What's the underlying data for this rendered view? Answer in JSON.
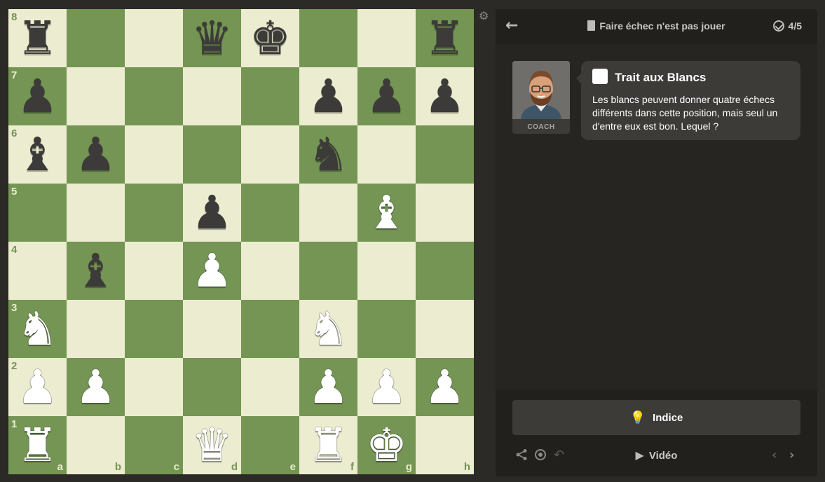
{
  "board": {
    "files": [
      "a",
      "b",
      "c",
      "d",
      "e",
      "f",
      "g",
      "h"
    ],
    "ranks": [
      "8",
      "7",
      "6",
      "5",
      "4",
      "3",
      "2",
      "1"
    ],
    "pieces": {
      "a8": {
        "color": "b",
        "type": "rook",
        "glyph": "♜"
      },
      "d8": {
        "color": "b",
        "type": "queen",
        "glyph": "♛"
      },
      "e8": {
        "color": "b",
        "type": "king",
        "glyph": "♚"
      },
      "h8": {
        "color": "b",
        "type": "rook",
        "glyph": "♜"
      },
      "a7": {
        "color": "b",
        "type": "pawn",
        "glyph": "♟"
      },
      "f7": {
        "color": "b",
        "type": "pawn",
        "glyph": "♟"
      },
      "g7": {
        "color": "b",
        "type": "pawn",
        "glyph": "♟"
      },
      "h7": {
        "color": "b",
        "type": "pawn",
        "glyph": "♟"
      },
      "a6": {
        "color": "b",
        "type": "bishop",
        "glyph": "♝"
      },
      "b6": {
        "color": "b",
        "type": "pawn",
        "glyph": "♟"
      },
      "f6": {
        "color": "b",
        "type": "knight",
        "glyph": "♞"
      },
      "d5": {
        "color": "b",
        "type": "pawn",
        "glyph": "♟"
      },
      "g5": {
        "color": "w",
        "type": "bishop",
        "glyph": "♝"
      },
      "b4": {
        "color": "b",
        "type": "bishop",
        "glyph": "♝"
      },
      "d4": {
        "color": "w",
        "type": "pawn",
        "glyph": "♟"
      },
      "a3": {
        "color": "w",
        "type": "knight",
        "glyph": "♞"
      },
      "f3": {
        "color": "w",
        "type": "knight",
        "glyph": "♞"
      },
      "a2": {
        "color": "w",
        "type": "pawn",
        "glyph": "♟"
      },
      "b2": {
        "color": "w",
        "type": "pawn",
        "glyph": "♟"
      },
      "f2": {
        "color": "w",
        "type": "pawn",
        "glyph": "♟"
      },
      "g2": {
        "color": "w",
        "type": "pawn",
        "glyph": "♟"
      },
      "h2": {
        "color": "w",
        "type": "pawn",
        "glyph": "♟"
      },
      "a1": {
        "color": "w",
        "type": "rook",
        "glyph": "♜"
      },
      "d1": {
        "color": "w",
        "type": "queen",
        "glyph": "♛"
      },
      "f1": {
        "color": "w",
        "type": "rook",
        "glyph": "♜"
      },
      "g1": {
        "color": "w",
        "type": "king",
        "glyph": "♚"
      }
    }
  },
  "colors": {
    "light_square": "#ececd0",
    "dark_square": "#749553",
    "panel_bg": "#262522",
    "bubble_bg": "#3c3b38"
  },
  "header": {
    "lesson_title": "Faire échec n'est pas jouer",
    "progress": "4/5",
    "icons": {
      "back": "arrow-left-icon",
      "lesson": "book-icon",
      "progress": "check-circle-icon"
    }
  },
  "coach": {
    "label": "COACH"
  },
  "bubble": {
    "title": "Trait aux Blancs",
    "message": "Les blancs peuvent donner quatre échecs différents dans cette position, mais seul un d'entre eux est bon. Lequel ?"
  },
  "footer": {
    "hint_label": "Indice",
    "video_label": "Vidéo",
    "icons": [
      "share-icon",
      "target-icon",
      "undo-icon",
      "play-icon",
      "chevron-left-icon",
      "chevron-right-icon",
      "lightbulb-icon",
      "gear-icon"
    ]
  }
}
